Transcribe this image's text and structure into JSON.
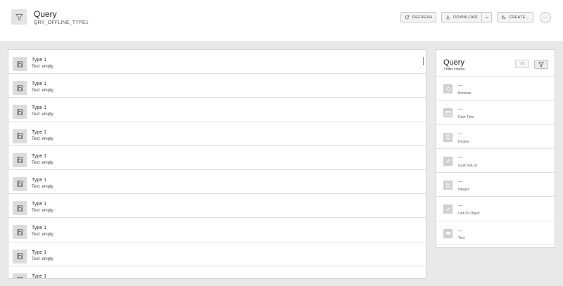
{
  "header": {
    "title": "Query",
    "subtitle": "QRY_OFFLINE_TYPE1",
    "icon": "filter-icon",
    "buttons": {
      "refresh": "REFRESH",
      "download": "DOWNLOAD",
      "create": "CREATE..."
    },
    "more": "···"
  },
  "list": {
    "items": [
      {
        "title": "Type 1",
        "subtitle": "Text: empty"
      },
      {
        "title": "Type 1",
        "subtitle": "Text: empty"
      },
      {
        "title": "Type 1",
        "subtitle": "Text: empty"
      },
      {
        "title": "Type 1",
        "subtitle": "Text: empty"
      },
      {
        "title": "Type 1",
        "subtitle": "Text: empty"
      },
      {
        "title": "Type 1",
        "subtitle": "Text: empty"
      },
      {
        "title": "Type 1",
        "subtitle": "Text: empty"
      },
      {
        "title": "Type 1",
        "subtitle": "Text: empty"
      },
      {
        "title": "Type 1",
        "subtitle": "Text: empty"
      },
      {
        "title": "Type 1",
        "subtitle": ""
      }
    ]
  },
  "filter_panel": {
    "title": "Query",
    "subtitle": "7 filter criteria",
    "clear_label": "⌫",
    "criteria": [
      {
        "value": "---",
        "label": "Boolean",
        "icon": "boolean-icon"
      },
      {
        "value": "---",
        "label": "Date Time",
        "icon": "calendar-icon"
      },
      {
        "value": "---",
        "label": "Double",
        "icon": "calculator-icon"
      },
      {
        "value": "---",
        "label": "Guid SelList",
        "icon": "link-icon"
      },
      {
        "value": "---",
        "label": "Integer",
        "icon": "calculator-icon"
      },
      {
        "value": "---",
        "label": "Link to Object",
        "icon": "link-icon"
      },
      {
        "value": "---",
        "label": "Text",
        "icon": "text-field-icon"
      }
    ]
  }
}
